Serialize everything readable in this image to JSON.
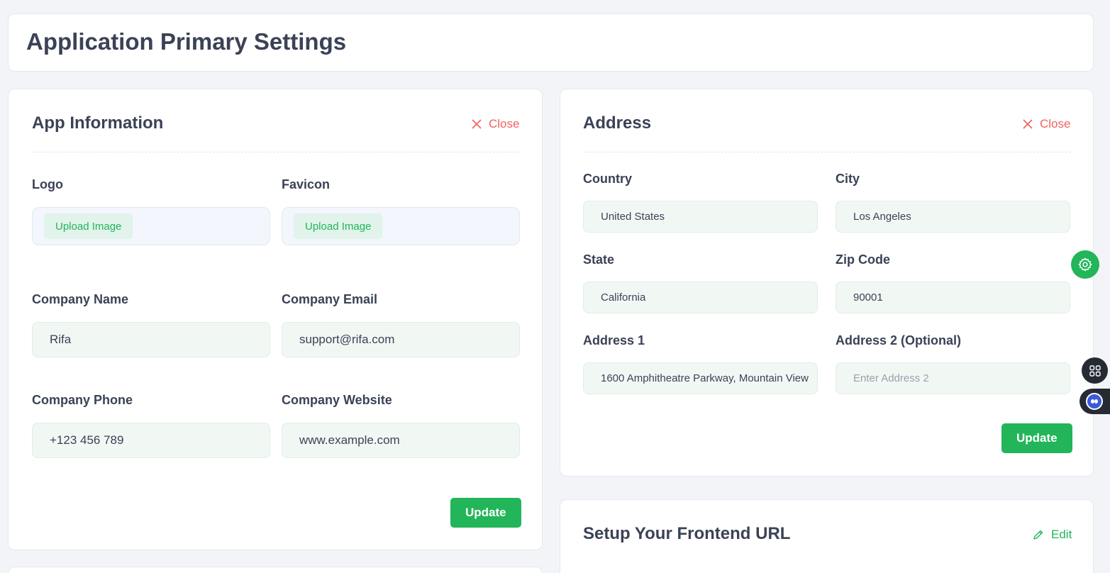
{
  "page": {
    "title": "Application Primary Settings"
  },
  "app_info": {
    "title": "App Information",
    "close_label": "Close",
    "logo_label": "Logo",
    "logo_button": "Upload Image",
    "favicon_label": "Favicon",
    "favicon_button": "Upload Image",
    "company_name_label": "Company Name",
    "company_name_value": "Rifa",
    "company_email_label": "Company Email",
    "company_email_value": "support@rifa.com",
    "company_phone_label": "Company Phone",
    "company_phone_value": "+123 456 789",
    "company_website_label": "Company Website",
    "company_website_value": "www.example.com",
    "update_label": "Update"
  },
  "address": {
    "title": "Address",
    "close_label": "Close",
    "country_label": "Country",
    "country_value": "United States",
    "city_label": "City",
    "city_value": "Los Angeles",
    "state_label": "State",
    "state_value": "California",
    "zip_label": "Zip Code",
    "zip_value": "90001",
    "address1_label": "Address 1",
    "address1_value": "1600 Amphitheatre Parkway, Mountain View",
    "address2_label": "Address 2 (Optional)",
    "address2_placeholder": "Enter Address 2",
    "update_label": "Update"
  },
  "frontend_url": {
    "title": "Setup Your Frontend URL",
    "edit_label": "Edit"
  },
  "floating": {
    "settings_icon": "gear-icon",
    "apps_icon": "grid-icon",
    "bot_icon": "bot-icon"
  },
  "colors": {
    "accent": "#22b55a",
    "danger": "#f0625f",
    "text": "#3b4256",
    "background": "#f3f4f8"
  }
}
